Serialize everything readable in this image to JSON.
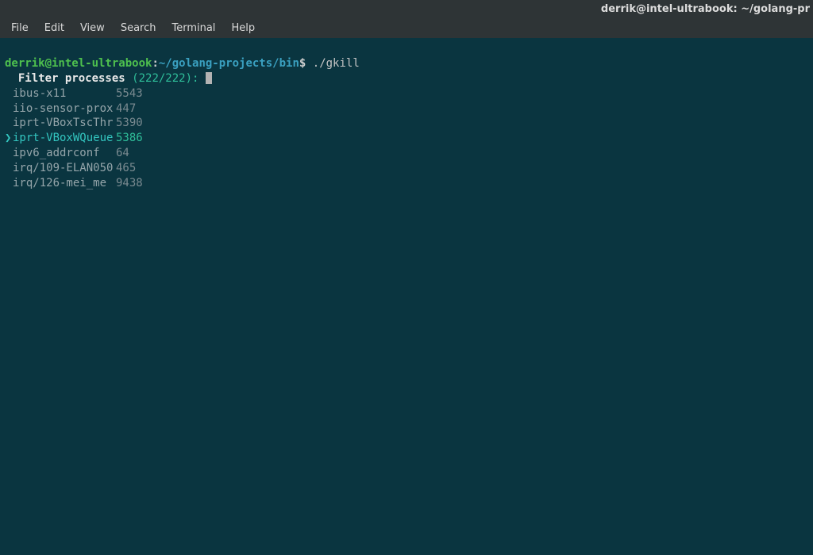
{
  "titlebar": {
    "text": "derrik@intel-ultrabook: ~/golang-pr"
  },
  "menubar": {
    "items": [
      "File",
      "Edit",
      "View",
      "Search",
      "Terminal",
      "Help"
    ]
  },
  "prompt": {
    "user_host": "derrik@intel-ultrabook",
    "colon": ":",
    "path": "~/golang-projects/bin",
    "dollar": "$",
    "command": "./gkill"
  },
  "filter": {
    "label": "Filter processes",
    "count": "(222/222):"
  },
  "processes": [
    {
      "name": "ibus-x11",
      "pid": "5543",
      "selected": false
    },
    {
      "name": "iio-sensor-prox",
      "pid": "447",
      "selected": false
    },
    {
      "name": "iprt-VBoxTscThr",
      "pid": "5390",
      "selected": false
    },
    {
      "name": "iprt-VBoxWQueue",
      "pid": "5386",
      "selected": true
    },
    {
      "name": "ipv6_addrconf",
      "pid": "64",
      "selected": false
    },
    {
      "name": "irq/109-ELAN050",
      "pid": "465",
      "selected": false
    },
    {
      "name": "irq/126-mei_me",
      "pid": "9438",
      "selected": false
    }
  ]
}
